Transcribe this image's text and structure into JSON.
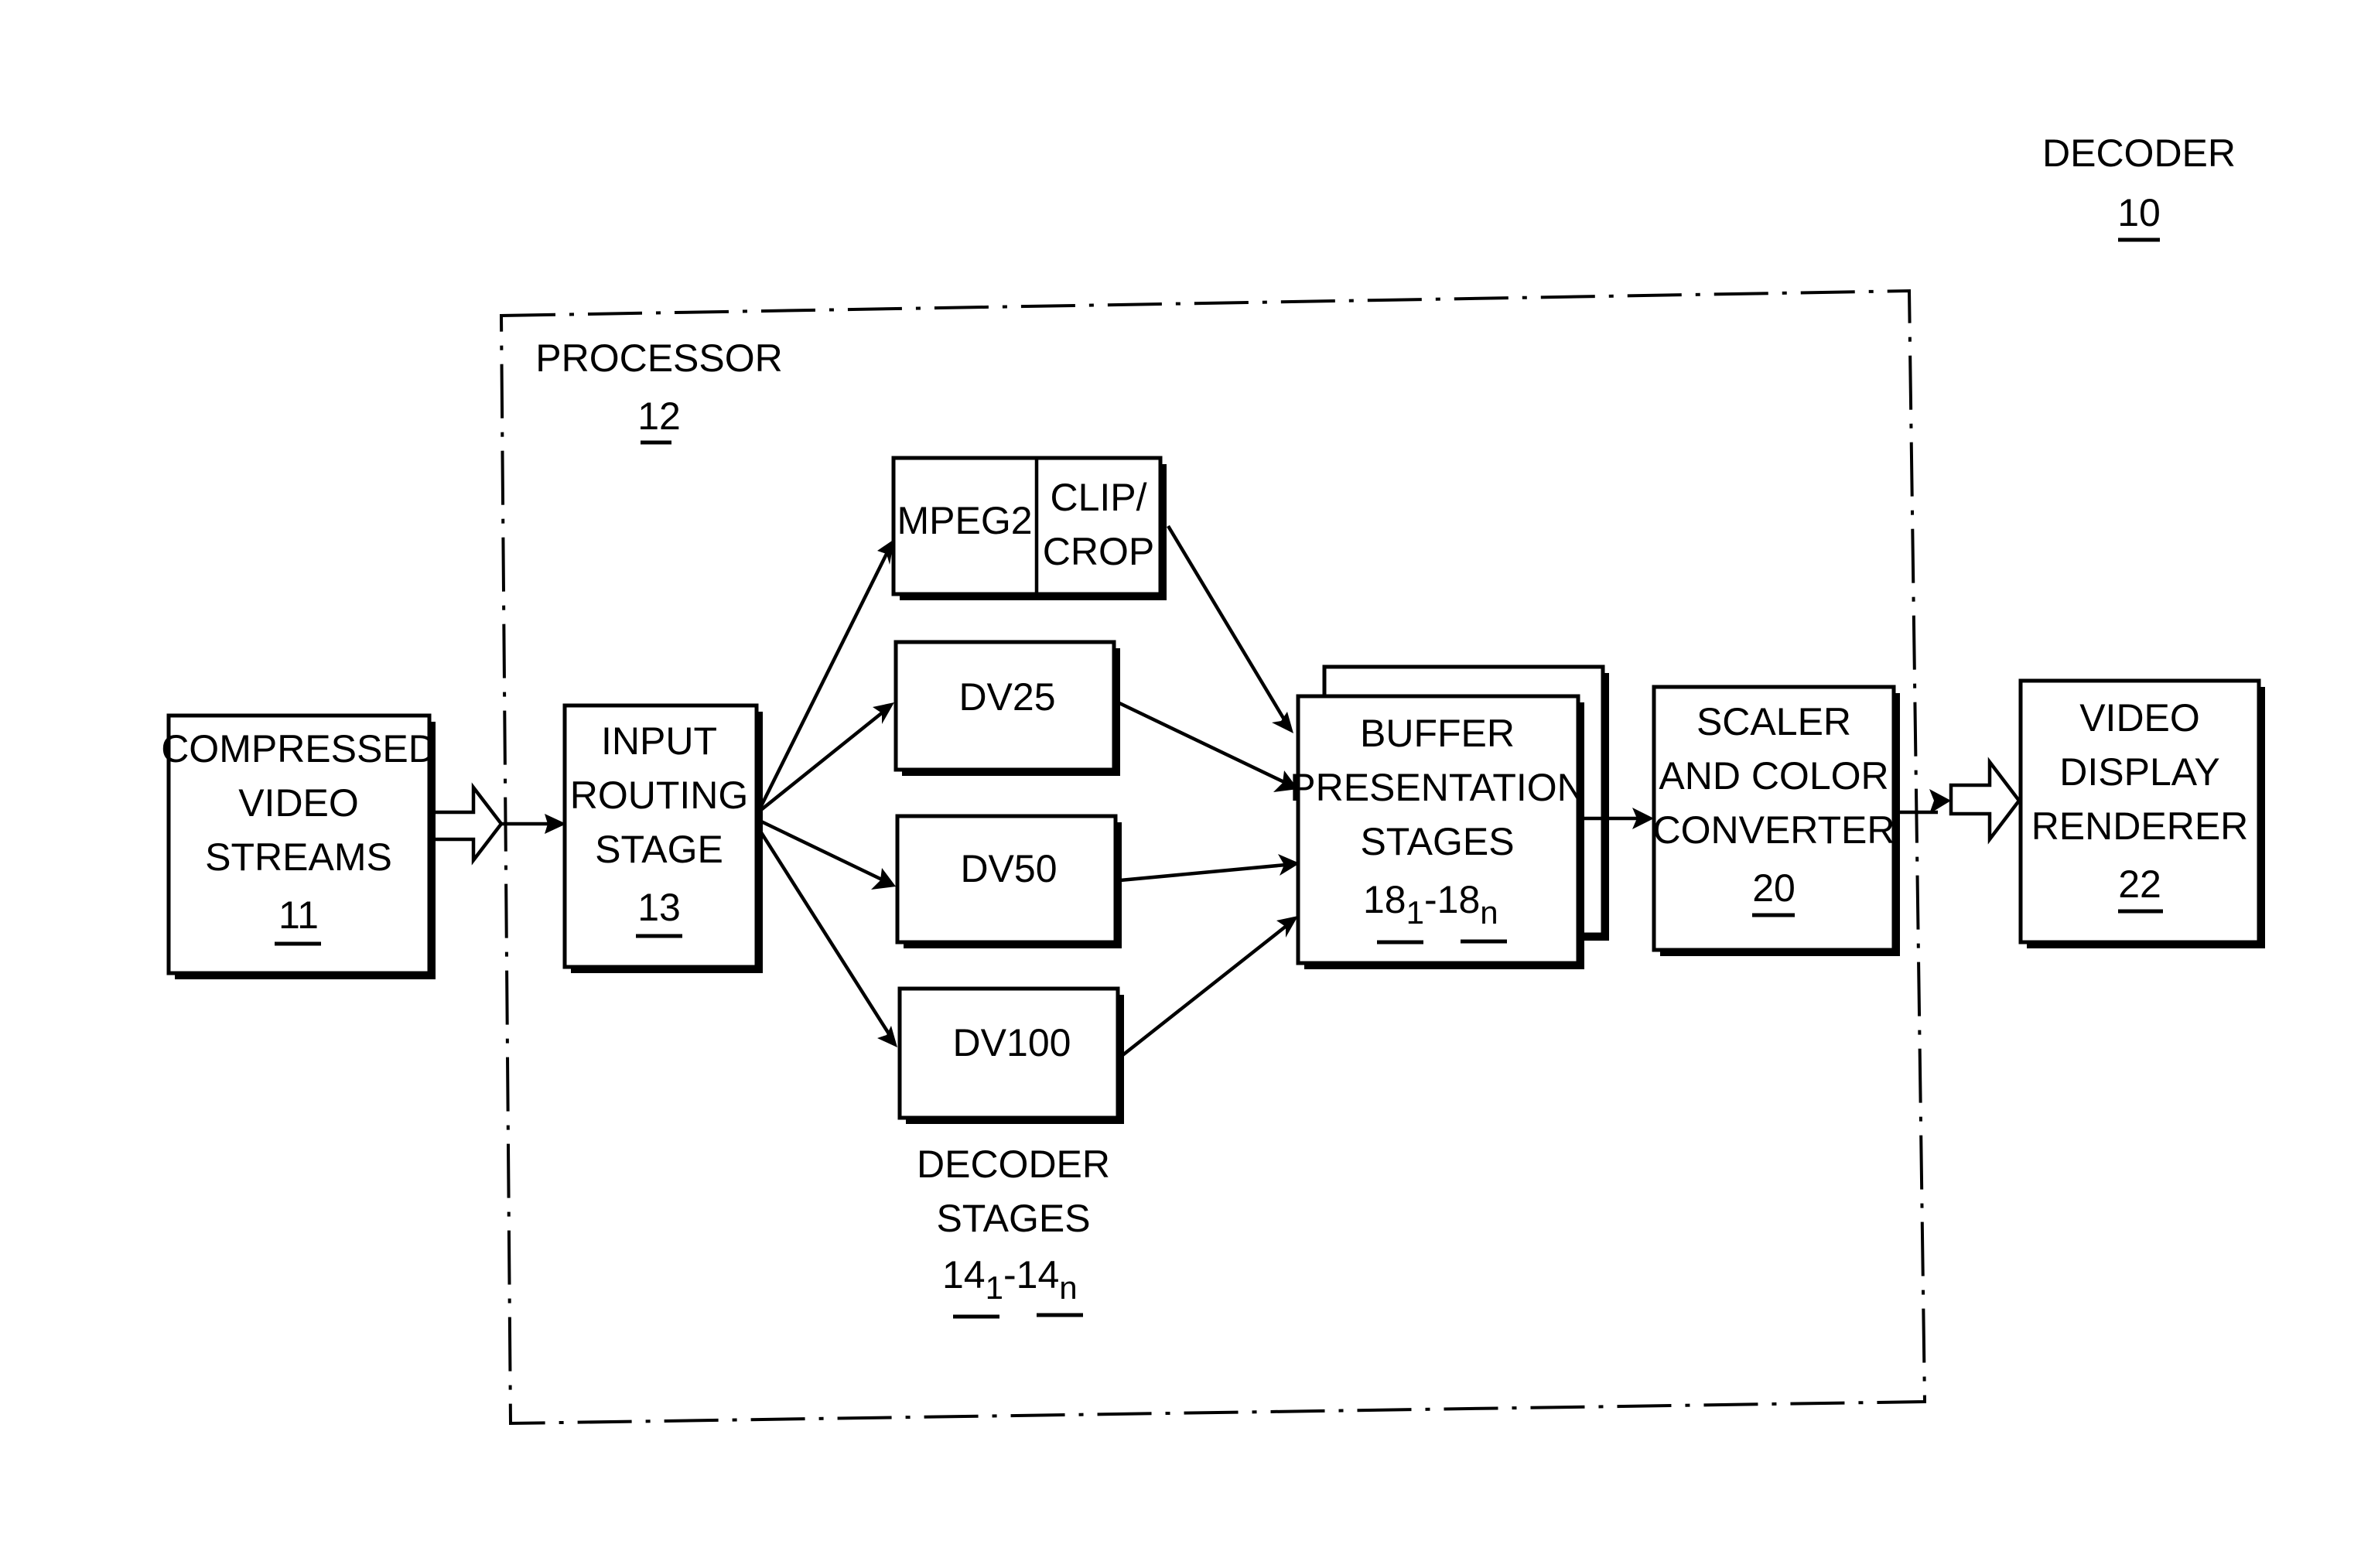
{
  "title": {
    "label": "DECODER",
    "ref": "10"
  },
  "processor": {
    "label": "PROCESSOR",
    "ref": "12"
  },
  "blocks": {
    "compressed": {
      "lines": [
        "COMPRESSED",
        "VIDEO",
        "STREAMS"
      ],
      "ref": "11"
    },
    "input_routing": {
      "lines": [
        "INPUT",
        "ROUTING",
        "STAGE"
      ],
      "ref": "13"
    },
    "mpeg2": {
      "label": "MPEG2"
    },
    "clip_crop": {
      "lines": [
        "CLIP/",
        "CROP"
      ]
    },
    "dv25": {
      "label": "DV25"
    },
    "dv50": {
      "label": "DV50"
    },
    "dv100": {
      "label": "DV100"
    },
    "buffer": {
      "lines": [
        "BUFFER",
        "PRESENTATION",
        "STAGES"
      ],
      "ref_a": "18",
      "sub_a": "1",
      "dash": "-",
      "ref_b": "18",
      "sub_b": "n"
    },
    "scaler": {
      "lines": [
        "SCALER",
        "AND COLOR",
        "CONVERTER"
      ],
      "ref": "20"
    },
    "renderer": {
      "lines": [
        "VIDEO",
        "DISPLAY",
        "RENDERER"
      ],
      "ref": "22"
    }
  },
  "decoder_stages": {
    "lines": [
      "DECODER",
      "STAGES"
    ],
    "ref_a": "14",
    "sub_a": "1",
    "dash": "-",
    "ref_b": "14",
    "sub_b": "n"
  }
}
